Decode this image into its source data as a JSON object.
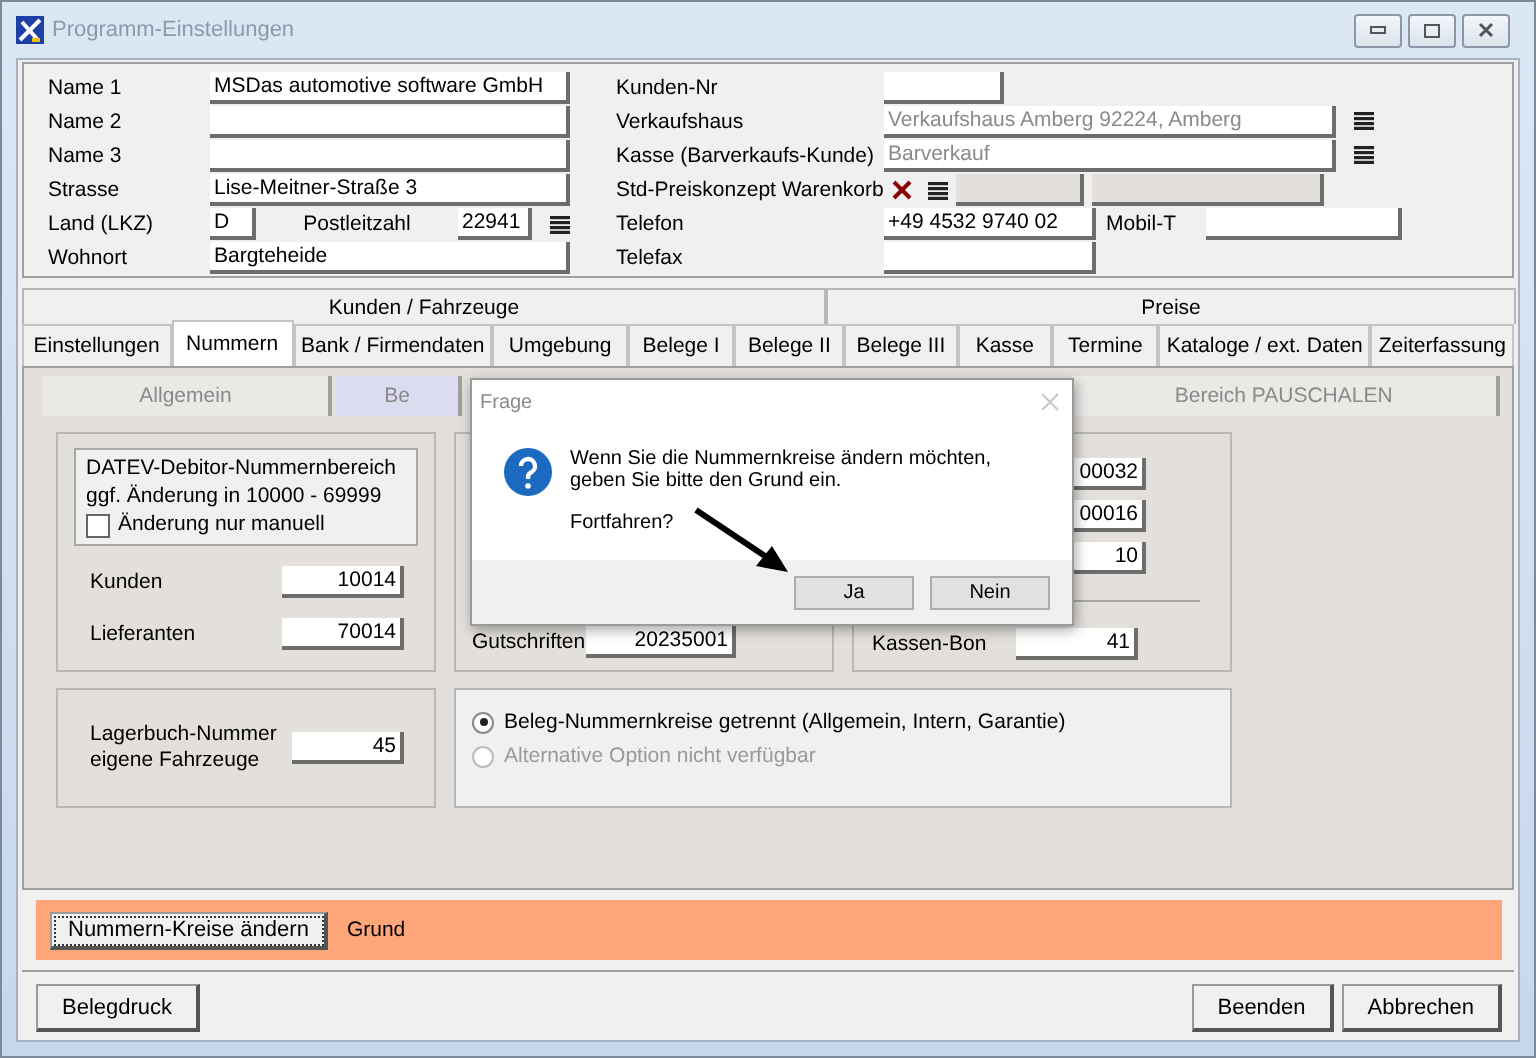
{
  "window": {
    "title": "Programm-Einstellungen"
  },
  "left_fields": [
    {
      "kind": "text",
      "label": "Name 1",
      "value": "MSDas automotive software GmbH"
    },
    {
      "kind": "text",
      "label": "Name 2"
    },
    {
      "kind": "text",
      "label": "Name 3"
    },
    {
      "kind": "text",
      "label": "Strasse",
      "value": "Lise-Meitner-Straße 3"
    },
    {
      "kind": "land",
      "label": "Land (LKZ)",
      "value": "D",
      "zip_label": "Postleitzahl",
      "zip": "22941"
    },
    {
      "kind": "text",
      "label": "Wohnort",
      "value": "Bargteheide"
    }
  ],
  "right_fields": [
    {
      "kind": "narrow",
      "label": "Kunden-Nr"
    },
    {
      "kind": "lookup",
      "label": "Verkaufshaus",
      "value": "Verkaufshaus Amberg 92224, Amberg"
    },
    {
      "kind": "lookup",
      "label": "Kasse (Barverkaufs-Kunde)",
      "value": "Barverkauf"
    },
    {
      "kind": "price",
      "label": "Std-Preiskonzept Warenkorb"
    },
    {
      "kind": "phone",
      "label": "Telefon",
      "value": "+49 4532 9740 02",
      "extra_label": "Mobil-T"
    },
    {
      "kind": "medium",
      "label": "Telefax"
    }
  ],
  "tab_groups": [
    {
      "label": "Kunden / Fahrzeuge"
    },
    {
      "label": "Preise"
    }
  ],
  "tabs": [
    {
      "label": "Einstellungen",
      "selected": false
    },
    {
      "label": "Nummern",
      "selected": true
    },
    {
      "label": "Bank / Firmendaten",
      "selected": false
    },
    {
      "label": "Umgebung",
      "selected": false
    },
    {
      "label": "Belege I",
      "selected": false
    },
    {
      "label": "Belege II",
      "selected": false
    },
    {
      "label": "Belege III",
      "selected": false
    },
    {
      "label": "Kasse",
      "selected": false
    },
    {
      "label": "Termine",
      "selected": false
    },
    {
      "label": "Kataloge / ext. Daten",
      "selected": false
    },
    {
      "label": "Zeiterfassung",
      "selected": false
    }
  ],
  "subtabs": [
    {
      "label": "Allgemein",
      "selected": false
    },
    {
      "label": "Be",
      "selected": true
    },
    {
      "label": "Bereich PAUSCHALEN",
      "selected": false
    }
  ],
  "datev": {
    "lines": [
      "DATEV-Debitor-Nummernbereich",
      "ggf. Änderung in 10000 - 69999"
    ],
    "checkbox": {
      "label": "Änderung nur manuell",
      "checked": false
    }
  },
  "customer_numbers": [
    {
      "label": "Kunden",
      "value": "10014"
    },
    {
      "label": "Lieferanten",
      "value": "70014"
    }
  ],
  "middle_box": {
    "fields": [
      {
        "label": "Gutschriften",
        "value": "20235001"
      }
    ]
  },
  "right_box": {
    "fields": [
      {
        "value": "00032"
      },
      {
        "value": "00016"
      },
      {
        "value": "10"
      }
    ],
    "bottom": {
      "label": "Kassen-Bon",
      "value": "41"
    }
  },
  "stock": {
    "label": "Lagerbuch-Nummer eigene Fahrzeuge",
    "value": "45"
  },
  "options": [
    {
      "label": "Beleg-Nummernkreise getrennt (Allgemein, Intern, Garantie)",
      "selected": true,
      "disabled": false
    },
    {
      "label": "Alternative Option nicht verfügbar",
      "selected": false,
      "disabled": true
    }
  ],
  "change_bar": {
    "button": "Nummern-Kreise ändern",
    "label": "Grund"
  },
  "footer": {
    "left": [
      "Belegdruck"
    ],
    "right": [
      "Beenden",
      "Abbrechen"
    ]
  },
  "dialog": {
    "title": "Frage",
    "message": "Wenn Sie die Nummernkreise ändern möchten, geben Sie bitte den Grund ein.",
    "question": "Fortfahren?",
    "buttons": [
      "Ja",
      "Nein"
    ]
  }
}
